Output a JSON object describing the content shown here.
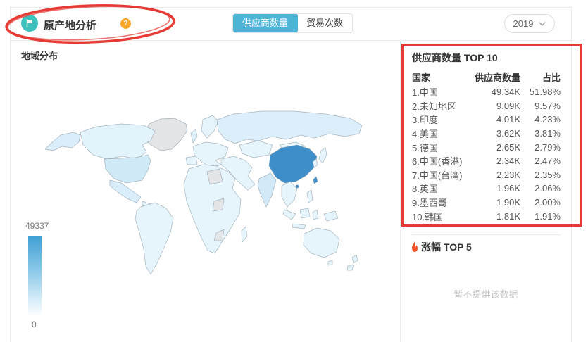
{
  "header": {
    "title": "原产地分析",
    "help": "?",
    "tabs": [
      {
        "label": "供应商数量",
        "active": true
      },
      {
        "label": "贸易次数",
        "active": false
      }
    ],
    "year": "2019"
  },
  "map_panel": {
    "title": "地域分布",
    "legend_max": "49337",
    "legend_min": "0"
  },
  "top10": {
    "title": "供应商数量 TOP 10",
    "col_country": "国家",
    "col_count": "供应商数量",
    "col_share": "占比",
    "rows": [
      {
        "country": "1.中国",
        "count": "49.34K",
        "share": "51.98%"
      },
      {
        "country": "2.未知地区",
        "count": "9.09K",
        "share": "9.57%"
      },
      {
        "country": "3.印度",
        "count": "4.01K",
        "share": "4.23%"
      },
      {
        "country": "4.美国",
        "count": "3.62K",
        "share": "3.81%"
      },
      {
        "country": "5.德国",
        "count": "2.65K",
        "share": "2.79%"
      },
      {
        "country": "6.中国(香港)",
        "count": "2.34K",
        "share": "2.47%"
      },
      {
        "country": "7.中国(台湾)",
        "count": "2.23K",
        "share": "2.35%"
      },
      {
        "country": "8.英国",
        "count": "1.96K",
        "share": "2.06%"
      },
      {
        "country": "9.墨西哥",
        "count": "1.90K",
        "share": "2.00%"
      },
      {
        "country": "10.韩国",
        "count": "1.81K",
        "share": "1.91%"
      }
    ]
  },
  "rise_panel": {
    "title": "涨幅 TOP 5",
    "empty": "暂不提供该数据"
  },
  "colors": {
    "active_tab": "#4db4d6",
    "title_icon_bg": "#3ec1bc",
    "help_icon_bg": "#f9a62a",
    "annotation_red": "#e53b34",
    "map_china_fill": "#3e8fc9",
    "map_base_fill": "#e6f4fc",
    "map_nodata_fill": "#e4e5e7",
    "legend_top": "#41a0d5",
    "legend_bottom": "#ffffff"
  },
  "chart_data": {
    "type": "heatmap",
    "title": "地域分布 (choropleth world map, supplier count by country)",
    "legend": {
      "max": 49337,
      "min": 0
    },
    "categories": [
      "中国",
      "未知地区",
      "印度",
      "美国",
      "德国",
      "中国(香港)",
      "中国(台湾)",
      "英国",
      "墨西哥",
      "韩国"
    ],
    "series": [
      {
        "name": "供应商数量",
        "values": [
          "49.34K",
          "9.09K",
          "4.01K",
          "3.62K",
          "2.65K",
          "2.34K",
          "2.23K",
          "1.96K",
          "1.90K",
          "1.81K"
        ]
      },
      {
        "name": "占比",
        "values": [
          "51.98%",
          "9.57%",
          "4.23%",
          "3.81%",
          "2.79%",
          "2.47%",
          "2.35%",
          "2.06%",
          "2.00%",
          "1.91%"
        ]
      }
    ]
  }
}
